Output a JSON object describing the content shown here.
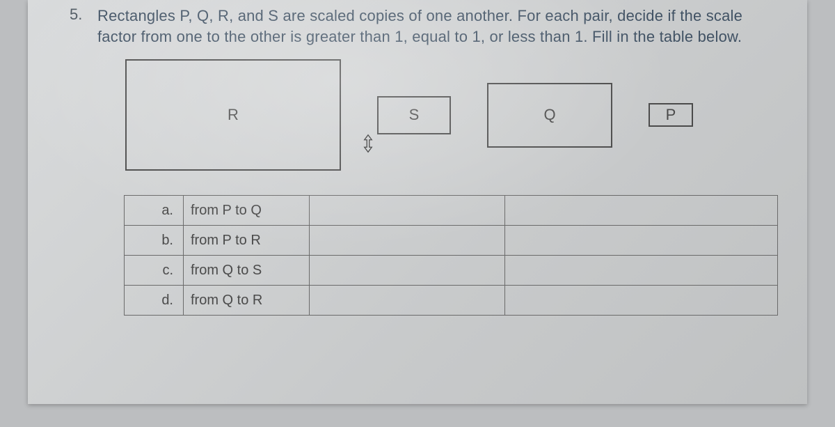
{
  "problem": {
    "number": "5.",
    "text": "Rectangles P, Q, R, and S are scaled copies of one another. For each pair, decide if the scale factor from one to the other is greater than 1, equal to 1, or less than 1. Fill in the table below."
  },
  "rectangles": {
    "R": "R",
    "S": "S",
    "Q": "Q",
    "P": "P"
  },
  "table": {
    "rows": [
      {
        "letter": "a.",
        "desc": "from P to Q"
      },
      {
        "letter": "b.",
        "desc": "from P to R"
      },
      {
        "letter": "c.",
        "desc": "from Q to S"
      },
      {
        "letter": "d.",
        "desc": "from Q to R"
      }
    ]
  }
}
